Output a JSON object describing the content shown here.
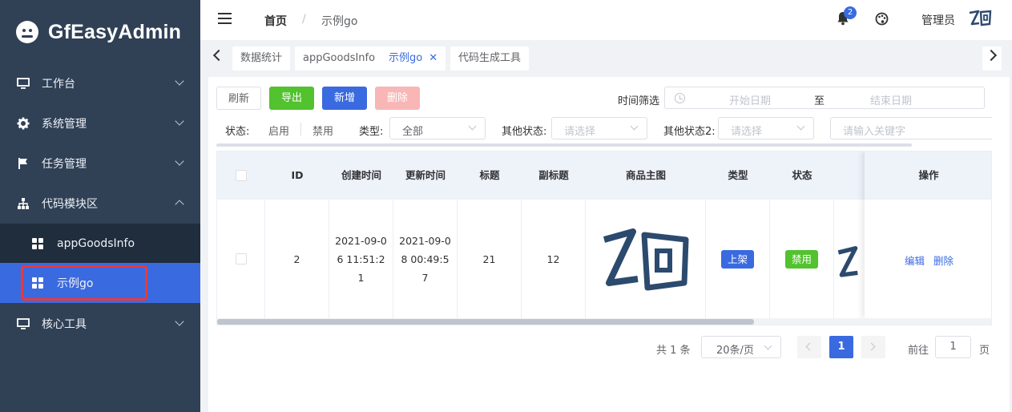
{
  "app": {
    "title": "GfEasyAdmin"
  },
  "sidebar": {
    "items": [
      {
        "label": "工作台",
        "icon": "monitor-icon"
      },
      {
        "label": "系统管理",
        "icon": "gear-icon"
      },
      {
        "label": "任务管理",
        "icon": "flag-icon"
      },
      {
        "label": "代码模块区",
        "icon": "tree-icon"
      },
      {
        "label": "核心工具",
        "icon": "monitor-icon"
      }
    ],
    "sub_items": [
      {
        "label": "appGoodsInfo",
        "icon": "grid-icon"
      },
      {
        "label": "示例go",
        "icon": "grid-icon"
      }
    ]
  },
  "header": {
    "breadcrumb": {
      "home": "首页",
      "separator": "/",
      "current": "示例go"
    },
    "notification_count": "2",
    "user_name": "管理员"
  },
  "tabs": [
    {
      "label": "数据统计"
    },
    {
      "label": "appGoodsInfo"
    },
    {
      "label": "示例go",
      "close": "✕"
    },
    {
      "label": "代码生成工具"
    }
  ],
  "toolbar": {
    "refresh": "刷新",
    "export": "导出",
    "add": "新增",
    "delete": "删除",
    "time_filter_label": "时间筛选",
    "start_placeholder": "开始日期",
    "range_separator": "至",
    "end_placeholder": "结束日期"
  },
  "filters": {
    "status_label": "状态:",
    "status_enabled": "启用",
    "status_disabled": "禁用",
    "type_label": "类型:",
    "type_value": "全部",
    "other_status_label": "其他状态:",
    "other_status_placeholder": "请选择",
    "other_status2_label": "其他状态2:",
    "other_status2_placeholder": "请选择",
    "keyword_placeholder": "请输入关键字"
  },
  "table": {
    "headers": [
      "ID",
      "创建时间",
      "更新时间",
      "标题",
      "副标题",
      "商品主图",
      "类型",
      "状态",
      "操作"
    ],
    "rows": [
      {
        "id": "2",
        "created": "2021-09-06 11:51:21",
        "updated": "2021-09-08 00:49:57",
        "title": "21",
        "subtitle": "12",
        "type_tag": "上架",
        "status_tag": "禁用",
        "actions": {
          "edit": "编辑",
          "delete": "删除"
        }
      }
    ]
  },
  "pagination": {
    "total": "共 1 条",
    "page_size": "20条/页",
    "current_page": "1",
    "goto_prefix": "前往",
    "goto_value": "1",
    "goto_suffix": "页"
  },
  "colors": {
    "sidebar_bg": "#304156",
    "submenu_bg": "#1f2d3d",
    "active_blue": "#3a6ae0",
    "success_green": "#52c22e",
    "danger_light": "#f9b6b6",
    "highlight_outline": "#e83a3a",
    "logo_navy": "#2c4a6e"
  }
}
